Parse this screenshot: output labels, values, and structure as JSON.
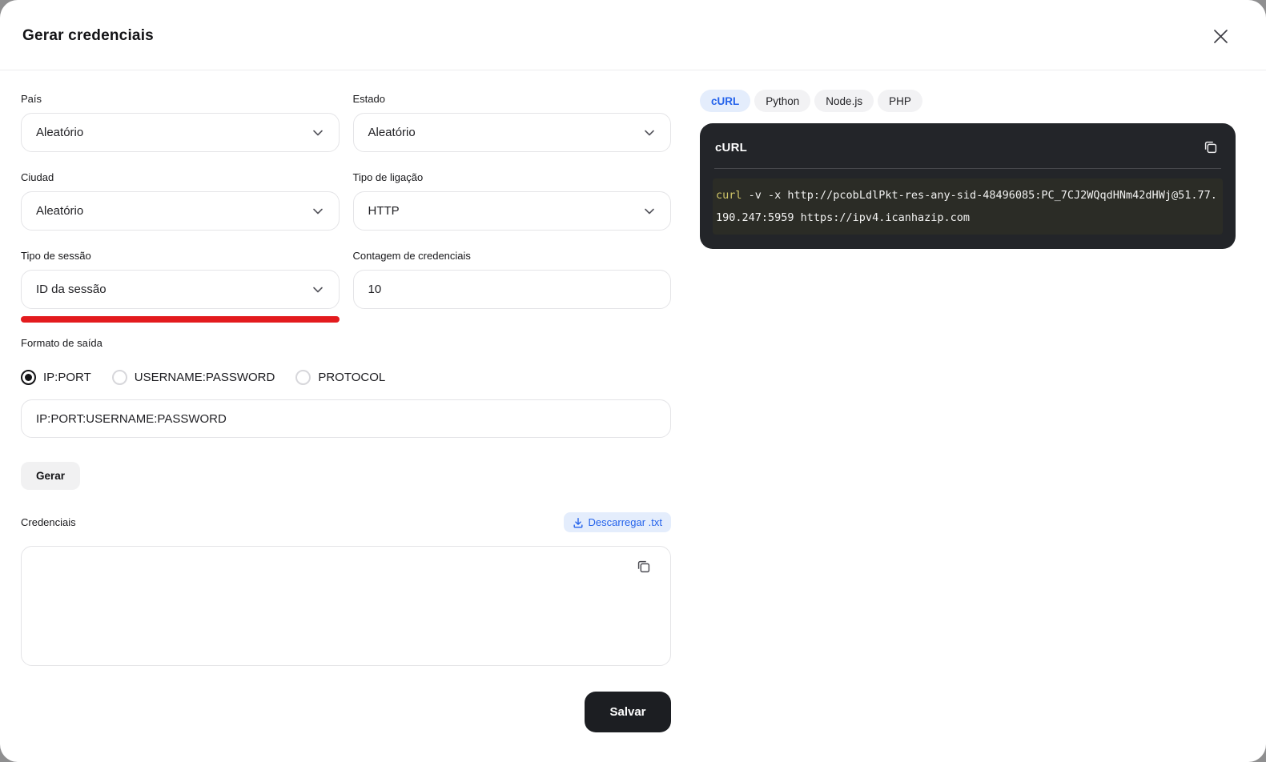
{
  "header": {
    "title": "Gerar credenciais"
  },
  "form": {
    "country": {
      "label": "País",
      "value": "Aleatório"
    },
    "state": {
      "label": "Estado",
      "value": "Aleatório"
    },
    "city": {
      "label": "Ciudad",
      "value": "Aleatório"
    },
    "connection_type": {
      "label": "Tipo de ligação",
      "value": "HTTP"
    },
    "session_type": {
      "label": "Tipo de sessão",
      "value": "ID da sessão"
    },
    "credential_count": {
      "label": "Contagem de credenciais",
      "value": "10"
    },
    "output_format": {
      "label": "Formato de saída",
      "options": [
        {
          "label": "IP:PORT",
          "selected": true
        },
        {
          "label": "USERNAME:PASSWORD",
          "selected": false
        },
        {
          "label": "PROTOCOL",
          "selected": false
        }
      ],
      "pattern_value": "IP:PORT:USERNAME:PASSWORD"
    },
    "generate_button": "Gerar",
    "credentials": {
      "label": "Credenciais",
      "download_button": "Descarregar .txt",
      "textarea_value": ""
    },
    "save_button": "Salvar"
  },
  "code_panel": {
    "tabs": [
      {
        "label": "cURL",
        "active": true
      },
      {
        "label": "Python",
        "active": false
      },
      {
        "label": "Node.js",
        "active": false
      },
      {
        "label": "PHP",
        "active": false
      }
    ],
    "card_title": "cURL",
    "code": {
      "keyword": "curl",
      "rest": " -v -x http://pcobLdlPkt-res-any-sid-48496085:PC_7CJ2WQqdHNm42dHWj@51.77.190.247:5959 https://ipv4.icanhazip.com"
    }
  },
  "colors": {
    "accent_blue": "#2563eb",
    "accent_blue_bg": "#e4edfc",
    "error_red": "#e31b1e",
    "code_bg": "#232529",
    "code_highlight_bg": "#2b2c26",
    "code_keyword": "#cfc568",
    "save_btn_bg": "#1c1e22"
  }
}
